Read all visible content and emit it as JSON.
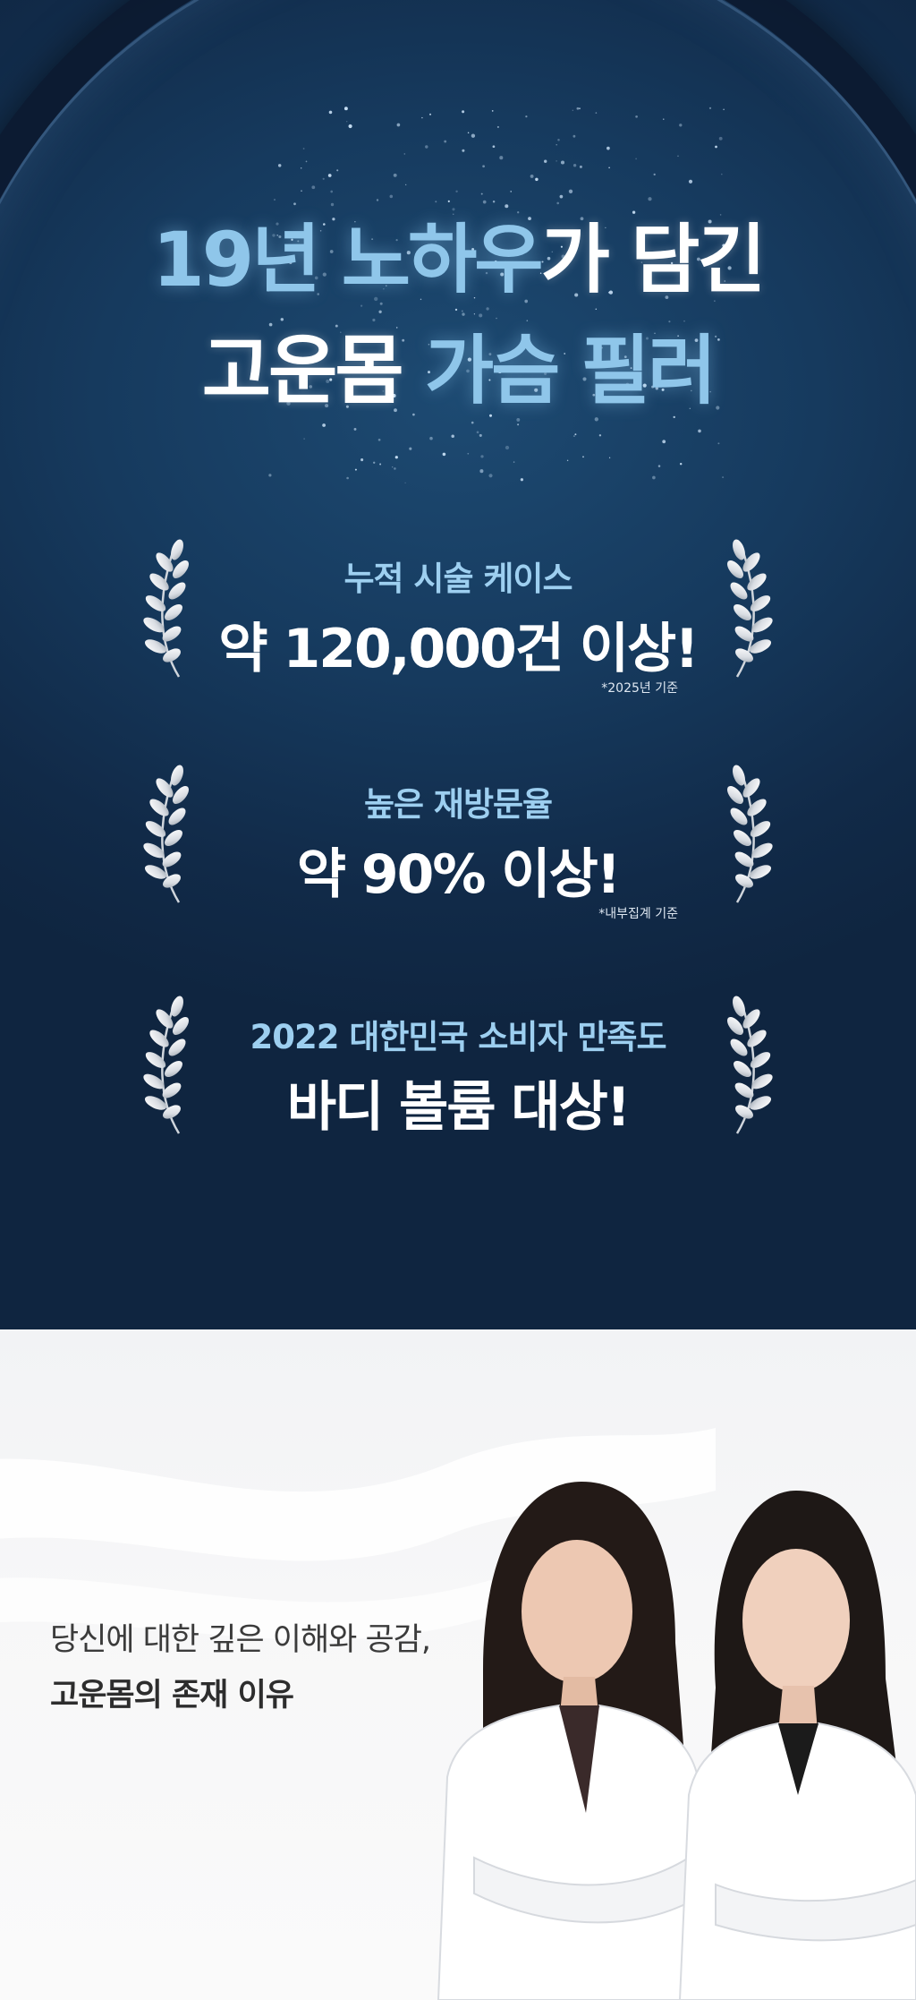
{
  "hero": {
    "title_line1_part1": "19년 노하우",
    "title_line1_part2": "가 담긴",
    "title_line2_part1": "고운몸",
    "title_line2_part2": " 가슴 필러"
  },
  "awards": [
    {
      "sub": "누적 시술 케이스",
      "main": "약 120,000건 이상!",
      "note": "*2025년 기준"
    },
    {
      "sub": "높은 재방문율",
      "main": "약 90% 이상!",
      "note": "*내부집계 기준"
    },
    {
      "sub": "2022 대한민국 소비자 만족도",
      "main": "바디 볼륨 대상!",
      "note": ""
    }
  ],
  "lower": {
    "line1": "당신에 대한 깊은 이해와 공감,",
    "line2": "고운몸의 존재 이유"
  },
  "colors": {
    "hero_bg": "#163a5e",
    "accent_blue": "#8fc6ea",
    "laurel_silver": "#e6e9ee"
  },
  "icons": [
    "laurel-left-icon",
    "laurel-right-icon"
  ]
}
